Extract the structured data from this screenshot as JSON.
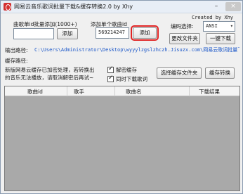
{
  "window": {
    "title": "网易云音乐歌词批量下载&缓存转换2.0 by Xhy",
    "min": "–",
    "close": "×"
  },
  "credit": "Created by Xhy",
  "batch": {
    "label": "曲歌单id批量添加(1000+)",
    "input_value": "",
    "add_label": "添加"
  },
  "single": {
    "label": "添加单个歌曲id",
    "input_value": "569214247",
    "add_label": "添加"
  },
  "encoding": {
    "label": "编码选择:",
    "value": "ANSI"
  },
  "change_folder_label": "更改文件夹",
  "download_all_label": "一键下载",
  "output": {
    "label": "输出路径:",
    "path": "C:\\Users\\Administrator\\Desktop\\wyyylzgslzhczh.Jisuzx.com\\网易云歌词批量下载"
  },
  "cache": {
    "label": "缓存路径:",
    "path": ""
  },
  "notice": {
    "line1": "新版网易云缓存已加密处理，若转换出",
    "line2": "的音乐无法播放，请取消解密后再试~"
  },
  "options": {
    "decrypt_label": "解密缓存",
    "decrypt_checked": true,
    "with_lyrics_label": "同时下载歌词",
    "with_lyrics_checked": true
  },
  "select_cache_folder_label": "选择缓存文件夹",
  "convert_cache_label": "缓存转换",
  "table": {
    "columns": [
      "歌曲id",
      "歌手",
      "歌曲名",
      "下载结果"
    ]
  }
}
